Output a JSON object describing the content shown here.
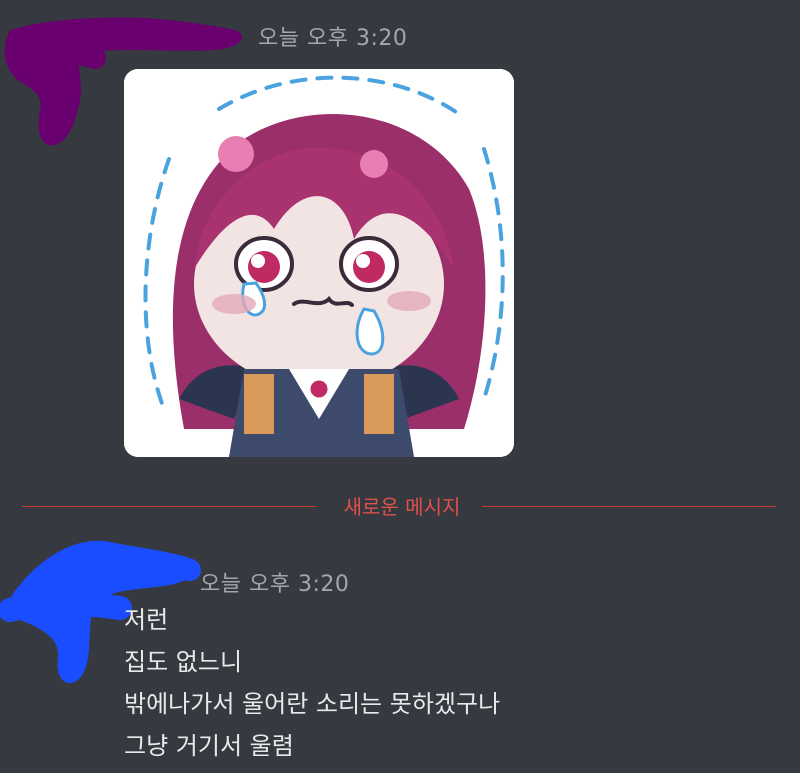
{
  "message_group_1": {
    "timestamp": "오늘 오후 3:20",
    "sticker_icon": "crying-vampire-girl-sticker"
  },
  "divider": {
    "label": "새로운 메시지",
    "color": "#e0504a"
  },
  "message_group_2": {
    "timestamp": "오늘 오후 3:20",
    "lines": [
      "저런",
      "집도 없느니",
      "밖에나가서 울어란 소리는 못하겠구나",
      "그냥 거기서 울렴"
    ]
  },
  "colors": {
    "background": "#36393f",
    "timestamp": "#a3a6aa",
    "message_text": "#e8e9ea",
    "redaction_1": "#6a0070",
    "redaction_2": "#1a4dff"
  }
}
